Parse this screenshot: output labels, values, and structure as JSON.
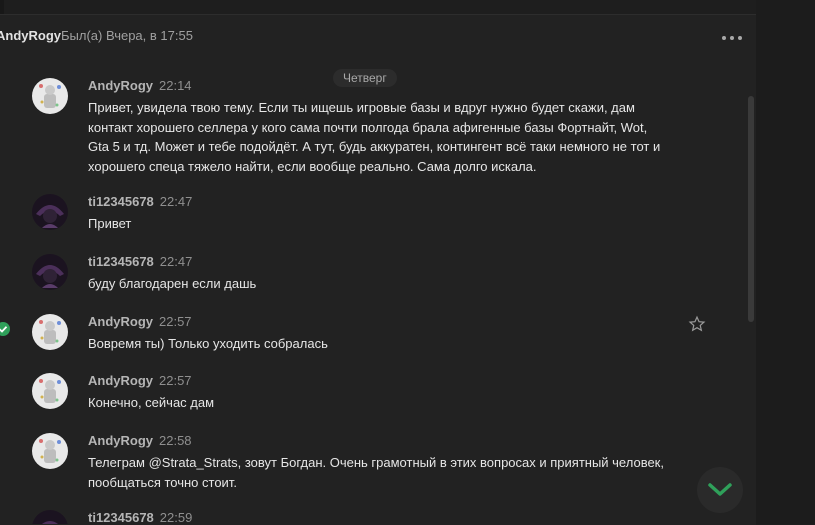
{
  "header": {
    "name": "AndyRogy",
    "status": "Был(а) Вчера, в 17:55"
  },
  "day_separator": "Четверг",
  "messages": [
    {
      "author": "AndyRogy",
      "time": "22:14",
      "text": "Привет, увидела твою тему. Если ты ищешь игровые базы и вдруг нужно будет скажи, дам контакт хорошего селлера у кого сама почти полгода брала афигенные базы Фортнайт, Wot, Gta 5 и тд. Может и тебе подойдёт. А тут, будь аккуратен, контингент всё таки немного не тот и хорошего спеца тяжело найти, если вообще реально. Сама долго искала."
    },
    {
      "author": "ti12345678",
      "time": "22:47",
      "text": "Привет"
    },
    {
      "author": "ti12345678",
      "time": "22:47",
      "text": "буду благодарен если дашь"
    },
    {
      "author": "AndyRogy",
      "time": "22:57",
      "text": "Вовремя ты) Только уходить собралась"
    },
    {
      "author": "AndyRogy",
      "time": "22:57",
      "text": "Конечно, сейчас дам"
    },
    {
      "author": "AndyRogy",
      "time": "22:58",
      "text": "Телеграм @Strata_Strats, зовут Богдан. Очень грамотный в этих вопросах и приятный человек, пообщаться точно стоит."
    },
    {
      "author": "ti12345678",
      "time": "22:59",
      "text": ""
    }
  ],
  "colors": {
    "background": "#222222",
    "accent": "#2fa05a"
  },
  "icons": {
    "more": "more-dots-icon",
    "star": "star-icon",
    "scroll_down": "chevron-down-icon",
    "read": "check-icon"
  }
}
